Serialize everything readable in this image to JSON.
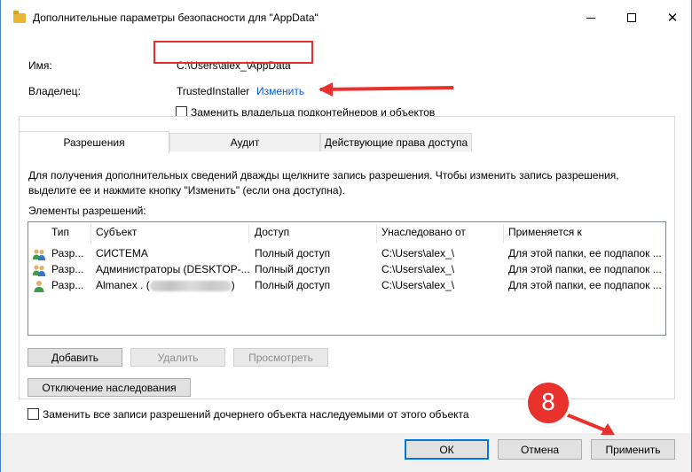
{
  "window": {
    "title": "Дополнительные параметры безопасности  для \"AppData\""
  },
  "info": {
    "name_label": "Имя:",
    "name_value": "C:\\Users\\alex_\\AppData",
    "owner_label": "Владелец:",
    "owner_value": "TrustedInstaller",
    "owner_change_link": "Изменить",
    "replace_owner_label": "Заменить владельца подконтейнеров и объектов"
  },
  "tabs": [
    {
      "label": "Разрешения",
      "active": true
    },
    {
      "label": "Аудит",
      "active": false
    },
    {
      "label": "Действующие права доступа",
      "active": false
    }
  ],
  "description": "Для получения дополнительных сведений дважды щелкните запись разрешения. Чтобы изменить запись разрешения, выделите ее и нажмите кнопку \"Изменить\" (если она доступна).",
  "list": {
    "title": "Элементы разрешений:",
    "columns": [
      "Тип",
      "Субъект",
      "Доступ",
      "Унаследовано от",
      "Применяется к"
    ],
    "rows": [
      {
        "type": "Разр...",
        "subject": "СИСТЕМА",
        "access": "Полный доступ",
        "inherited": "C:\\Users\\alex_\\",
        "applies": "Для этой папки, ее подпапок ..."
      },
      {
        "type": "Разр...",
        "subject": "Администраторы (DESKTOP-...",
        "access": "Полный доступ",
        "inherited": "C:\\Users\\alex_\\",
        "applies": "Для этой папки, ее подпапок ..."
      },
      {
        "type": "Разр...",
        "subject": "Almanex . (",
        "subject_suffix": ")",
        "access": "Полный доступ",
        "inherited": "C:\\Users\\alex_\\",
        "applies": "Для этой папки, ее подпапок ..."
      }
    ]
  },
  "buttons": {
    "add": "Добавить",
    "remove": "Удалить",
    "view": "Просмотреть",
    "disable_inheritance": "Отключение наследования",
    "ok": "ОК",
    "cancel": "Отмена",
    "apply": "Применить"
  },
  "replace_child_label": "Заменить все записи разрешений дочернего объекта наследуемыми от этого объекта",
  "annotation": {
    "step_number": "8",
    "color": "#e9322e"
  }
}
